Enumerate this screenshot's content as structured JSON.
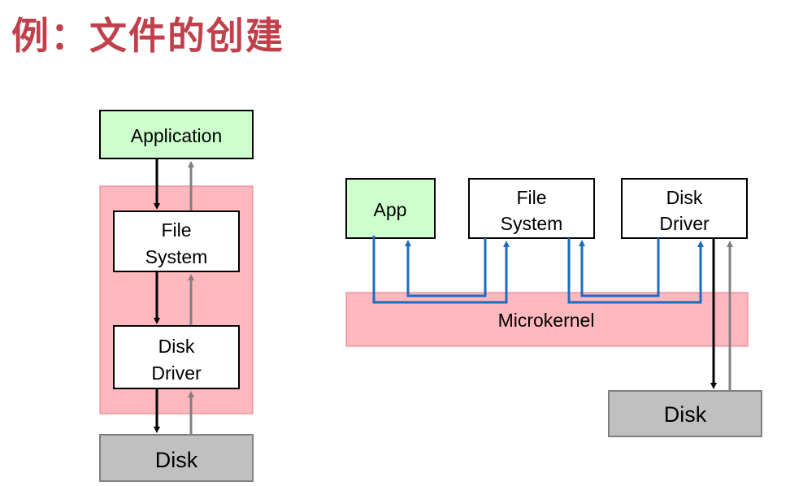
{
  "title": "例：文件的创建",
  "colors": {
    "title": "#c0404c",
    "app_fill": "#ccffcc",
    "kernel_fill": "#ffb8be",
    "disk_fill": "#c0c0c0",
    "black_arrow": "#000000",
    "gray_arrow": "#808080",
    "blue_arrow": "#1a6cc0"
  },
  "monolithic": {
    "application": "Application",
    "file_system": [
      "File",
      "System"
    ],
    "disk_driver": [
      "Disk",
      "Driver"
    ],
    "disk": "Disk"
  },
  "microkernel": {
    "app": "App",
    "file_system": [
      "File",
      "System"
    ],
    "disk_driver": [
      "Disk",
      "Driver"
    ],
    "kernel": "Microkernel",
    "disk": "Disk"
  }
}
